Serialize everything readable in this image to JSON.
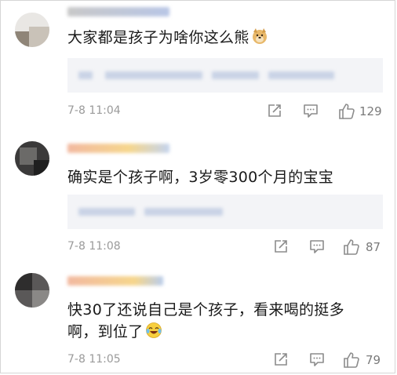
{
  "comments": [
    {
      "text": "大家都是孩子为啥你这么熊",
      "emoji": "doge-emoji",
      "time": "7-8 11:04",
      "likes": "129"
    },
    {
      "text": "确实是个孩子啊，3岁零300个月的宝宝",
      "time": "7-8 11:08",
      "likes": "87"
    },
    {
      "text_line1": "快30了还说自己是个孩子，看来喝的挺多",
      "text_line2": "啊，到位了",
      "emoji": "laugh-cry-emoji",
      "time": "7-8 11:05",
      "likes": "79"
    }
  ],
  "icons": {
    "share": "share-icon",
    "reply": "comment-icon",
    "like": "thumbs-up-icon"
  }
}
